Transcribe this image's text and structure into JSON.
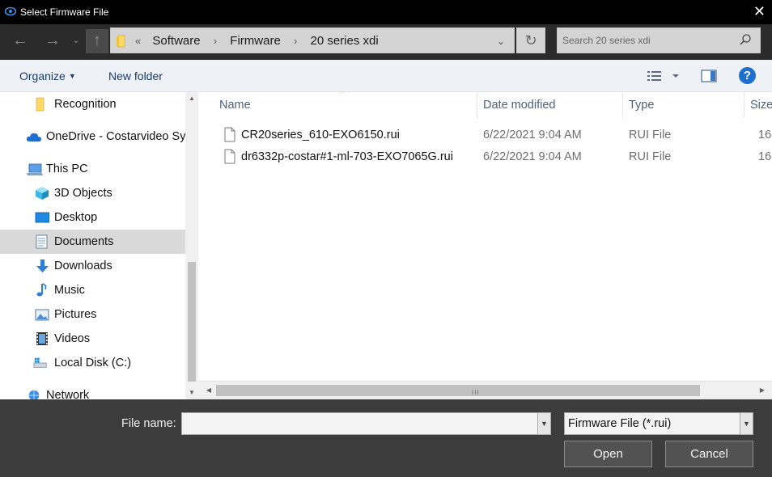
{
  "window": {
    "title": "Select Firmware File",
    "close_glyph": "✕"
  },
  "nav": {
    "back_glyph": "←",
    "forward_glyph": "→",
    "recent_glyph": "⌄",
    "up_glyph": "↑",
    "breadcrumb_prefix": "«",
    "breadcrumbs": [
      "Software",
      "Firmware",
      "20 series xdi"
    ],
    "breadcrumb_sep": "›",
    "dropdown_glyph": "⌄",
    "refresh_glyph": "↻",
    "search_placeholder": "Search 20 series xdi"
  },
  "toolbar": {
    "organize": "Organize",
    "organize_caret": "▼",
    "new_folder": "New folder",
    "help": "?",
    "view_caret": "▼"
  },
  "sidebar": {
    "items": [
      {
        "label": "Recognition",
        "icon": "folder-icon"
      },
      {
        "label": "OneDrive - Costarvideo Sy",
        "icon": "cloud-icon"
      },
      {
        "label": "This PC",
        "icon": "computer-icon"
      },
      {
        "label": "3D Objects",
        "icon": "cube-icon"
      },
      {
        "label": "Desktop",
        "icon": "desktop-icon"
      },
      {
        "label": "Documents",
        "icon": "document-icon",
        "selected": true
      },
      {
        "label": "Downloads",
        "icon": "download-icon"
      },
      {
        "label": "Music",
        "icon": "music-icon"
      },
      {
        "label": "Pictures",
        "icon": "pictures-icon"
      },
      {
        "label": "Videos",
        "icon": "videos-icon"
      },
      {
        "label": "Local Disk (C:)",
        "icon": "disk-icon"
      },
      {
        "label": "Network",
        "icon": "network-icon"
      }
    ],
    "scroll_up_glyph": "▲",
    "scroll_down_glyph": "▼"
  },
  "files": {
    "columns": {
      "name": "Name",
      "date": "Date modified",
      "type": "Type",
      "size": "Size"
    },
    "sort_glyph": "^",
    "rows": [
      {
        "name": "CR20series_610-EXO6150.rui",
        "date": "6/22/2021 9:04 AM",
        "type": "RUI File",
        "size": "16"
      },
      {
        "name": "dr6332p-costar#1-ml-703-EXO7065G.rui",
        "date": "6/22/2021 9:04 AM",
        "type": "RUI File",
        "size": "16"
      }
    ],
    "hscroll_left": "◀",
    "hscroll_right": "▶",
    "hscroll_grip": "III"
  },
  "footer": {
    "file_name_label": "File name:",
    "file_name_value": "",
    "dropdown_glyph": "▼",
    "filter_value": "Firmware File (*.rui)",
    "open": "Open",
    "cancel": "Cancel"
  }
}
